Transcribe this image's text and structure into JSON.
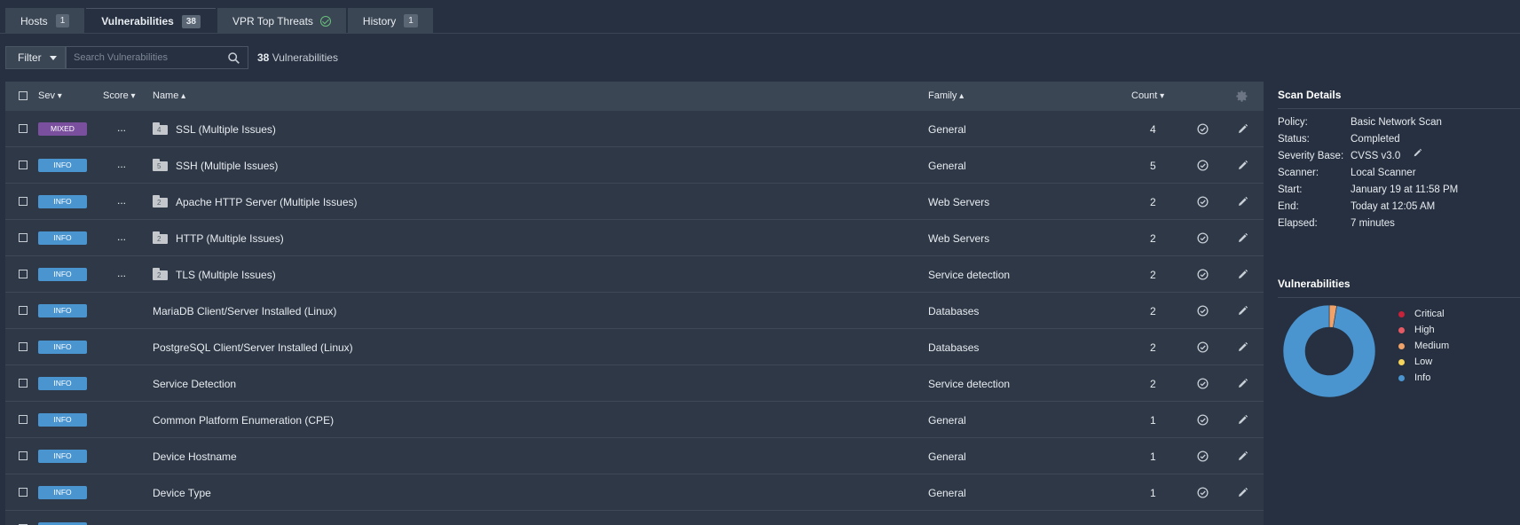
{
  "tabs": [
    {
      "label": "Hosts",
      "count": "1"
    },
    {
      "label": "Vulnerabilities",
      "count": "38"
    },
    {
      "label": "VPR Top Threats"
    },
    {
      "label": "History",
      "count": "1"
    }
  ],
  "filter": {
    "label": "Filter",
    "placeholder": "Search Vulnerabilities",
    "count": "38",
    "count_suffix": " Vulnerabilities"
  },
  "table": {
    "headers": {
      "sev": "Sev",
      "score": "Score",
      "name": "Name",
      "family": "Family",
      "count": "Count"
    },
    "rows": [
      {
        "sev": "MIXED",
        "score": "...",
        "folder": "4",
        "name": "SSL (Multiple Issues)",
        "family": "General",
        "count": "4"
      },
      {
        "sev": "INFO",
        "score": "...",
        "folder": "5",
        "name": "SSH (Multiple Issues)",
        "family": "General",
        "count": "5"
      },
      {
        "sev": "INFO",
        "score": "...",
        "folder": "2",
        "name": "Apache HTTP Server (Multiple Issues)",
        "family": "Web Servers",
        "count": "2"
      },
      {
        "sev": "INFO",
        "score": "...",
        "folder": "2",
        "name": "HTTP (Multiple Issues)",
        "family": "Web Servers",
        "count": "2"
      },
      {
        "sev": "INFO",
        "score": "...",
        "folder": "2",
        "name": "TLS (Multiple Issues)",
        "family": "Service detection",
        "count": "2"
      },
      {
        "sev": "INFO",
        "score": "",
        "folder": "",
        "name": "MariaDB Client/Server Installed (Linux)",
        "family": "Databases",
        "count": "2"
      },
      {
        "sev": "INFO",
        "score": "",
        "folder": "",
        "name": "PostgreSQL Client/Server Installed (Linux)",
        "family": "Databases",
        "count": "2"
      },
      {
        "sev": "INFO",
        "score": "",
        "folder": "",
        "name": "Service Detection",
        "family": "Service detection",
        "count": "2"
      },
      {
        "sev": "INFO",
        "score": "",
        "folder": "",
        "name": "Common Platform Enumeration (CPE)",
        "family": "General",
        "count": "1"
      },
      {
        "sev": "INFO",
        "score": "",
        "folder": "",
        "name": "Device Hostname",
        "family": "General",
        "count": "1"
      },
      {
        "sev": "INFO",
        "score": "",
        "folder": "",
        "name": "Device Type",
        "family": "General",
        "count": "1"
      },
      {
        "sev": "INFO",
        "score": "",
        "folder": "",
        "name": "",
        "family": "",
        "count": ""
      }
    ]
  },
  "scan_details": {
    "title": "Scan Details",
    "items": [
      {
        "k": "Policy:",
        "v": "Basic Network Scan"
      },
      {
        "k": "Status:",
        "v": "Completed"
      },
      {
        "k": "Severity Base:",
        "v": "CVSS v3.0"
      },
      {
        "k": "Scanner:",
        "v": "Local Scanner"
      },
      {
        "k": "Start:",
        "v": "January 19 at 11:58 PM"
      },
      {
        "k": "End:",
        "v": "Today at 12:05 AM"
      },
      {
        "k": "Elapsed:",
        "v": "7 minutes"
      }
    ]
  },
  "vulnerabilities": {
    "title": "Vulnerabilities",
    "legend": [
      {
        "label": "Critical",
        "color": "#c6223a"
      },
      {
        "label": "High",
        "color": "#e85a63"
      },
      {
        "label": "Medium",
        "color": "#f0a268"
      },
      {
        "label": "Low",
        "color": "#f5d45c"
      },
      {
        "label": "Info",
        "color": "#4a95d0"
      }
    ],
    "chart_data": {
      "type": "pie",
      "labels": [
        "Critical",
        "High",
        "Medium",
        "Low",
        "Info"
      ],
      "values": [
        0,
        0,
        1,
        0,
        37
      ]
    }
  },
  "colors": {
    "info": "#4a95d0",
    "mixed": "#7a4f9e",
    "medium": "#f0a268"
  }
}
